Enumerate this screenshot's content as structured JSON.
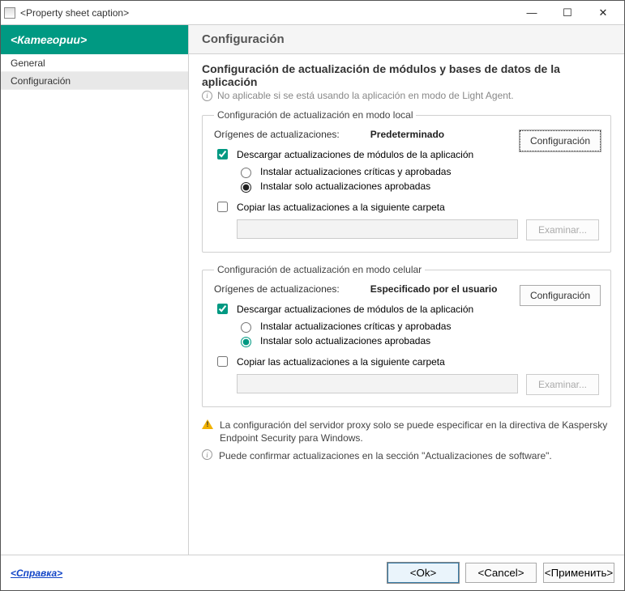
{
  "window": {
    "title": "<Property sheet caption>"
  },
  "sidebar": {
    "header": "<Категории>",
    "items": [
      "General",
      "Configuración"
    ]
  },
  "main": {
    "header": "Configuración",
    "heading": "Configuración de actualización de módulos y bases de datos de la aplicación",
    "infotext": "No aplicable si se está usando la aplicación en modo de Light Agent."
  },
  "group1": {
    "legend": "Configuración de actualización en modo local",
    "origins_label": "Orígenes de actualizaciones:",
    "origins_value": "Predeterminado",
    "config_btn": "Configuración",
    "chk_download": "Descargar actualizaciones de módulos de la aplicación",
    "radio1": "Instalar actualizaciones críticas y aprobadas",
    "radio2": "Instalar solo actualizaciones aprobadas",
    "chk_copy": "Copiar las actualizaciones a la siguiente carpeta",
    "browse": "Examinar..."
  },
  "group2": {
    "legend": "Configuración de actualización en modo celular",
    "origins_label": "Orígenes de actualizaciones:",
    "origins_value": "Especificado por el usuario",
    "config_btn": "Configuración",
    "chk_download": "Descargar actualizaciones de módulos de la aplicación",
    "radio1": "Instalar actualizaciones críticas y aprobadas",
    "radio2": "Instalar solo actualizaciones aprobadas",
    "chk_copy": "Copiar las actualizaciones a la siguiente carpeta",
    "browse": "Examinar..."
  },
  "notes": {
    "warn": "La configuración del servidor proxy solo se puede especificar en la directiva de Kaspersky Endpoint Security para Windows.",
    "info": "Puede confirmar actualizaciones en la sección \"Actualizaciones de software\"."
  },
  "footer": {
    "help": "<Справка>",
    "ok": "<Ok>",
    "cancel": "<Cancel>",
    "apply": "<Применить>"
  }
}
